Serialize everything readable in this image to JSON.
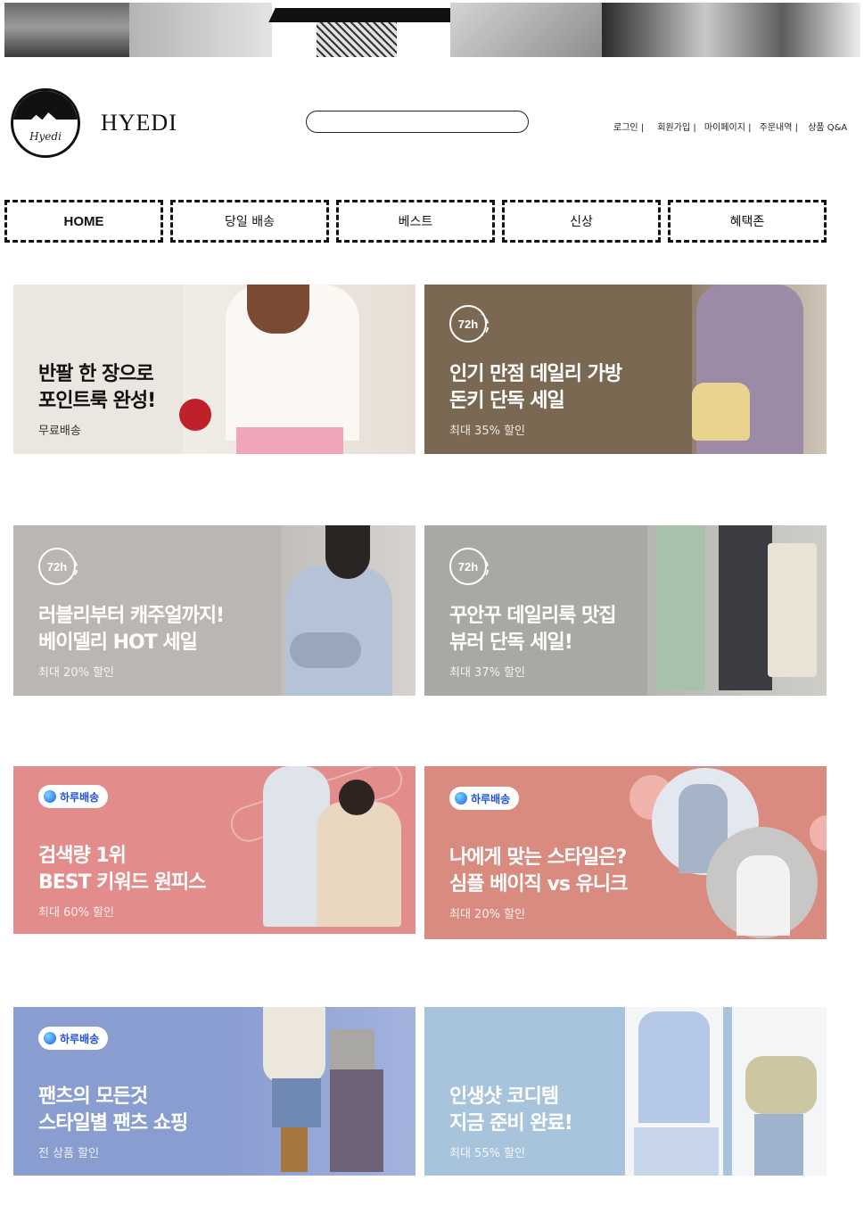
{
  "header": {
    "brand": "HYEDI",
    "logo_text": "Hyedi",
    "search_placeholder": "",
    "links": [
      "로그인 |",
      "회원가입 |",
      "마이페이지 |",
      "주문내역 |",
      "상품 Q&A"
    ]
  },
  "nav": {
    "items": [
      "HOME",
      "당일 배송",
      "베스트",
      "신상",
      "혜택존"
    ]
  },
  "banners": [
    {
      "title1": "반팔 한 장으로",
      "title2": "포인트룩 완성!",
      "sub": "무료배송",
      "badge": "",
      "color": "#e8e2da"
    },
    {
      "title1": "인기 만점 데일리 가방",
      "title2": "돈키 단독 세일",
      "sub": "최대 35% 할인",
      "badge": "72h",
      "color": "#7a6650"
    },
    {
      "title1": "러블리부터 캐주얼까지!",
      "title2": "베이델리 HOT 세일",
      "sub": "최대 20% 할인",
      "badge": "72h",
      "color": "#b9b6b2"
    },
    {
      "title1": "꾸안꾸 데일리룩 맛집",
      "title2": "뷰러 단독 세일!",
      "sub": "최대 37% 할인",
      "badge": "72h",
      "color": "#a9a9a5"
    },
    {
      "title1": "검색량 1위",
      "title2": "BEST 키워드 원피스",
      "sub": "최대 60% 할인",
      "badge": "하루배송",
      "color": "#e58e8e"
    },
    {
      "title1": "나에게 맞는 스타일은?",
      "title2": "심플 베이직 vs 유니크",
      "sub": "최대 20% 할인",
      "badge": "하루배송",
      "color": "#d98a80"
    },
    {
      "title1": "팬츠의 모든것",
      "title2": "스타일별 팬츠 쇼핑",
      "sub": "전 상품 할인",
      "badge": "하루배송",
      "color": "#8a9ed2"
    },
    {
      "title1": "인생샷 코디템",
      "title2": "지금 준비 완료!",
      "sub": "최대 55% 할인",
      "badge": "",
      "color": "#a7c3dc"
    }
  ]
}
